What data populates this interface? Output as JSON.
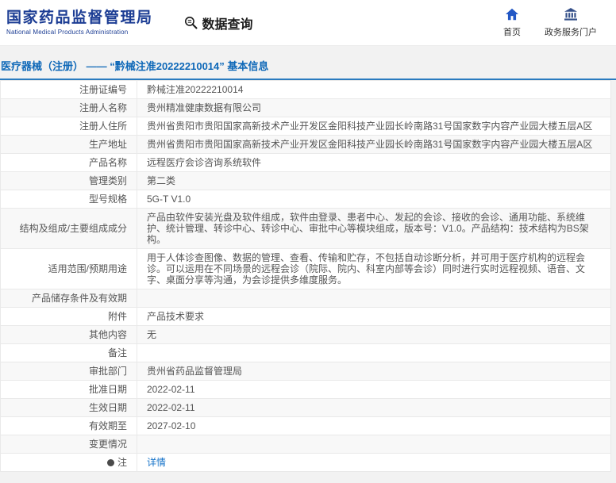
{
  "colors": {
    "brand_blue": "#1c3d94",
    "title_blue": "#0e68b8",
    "link_blue": "#1673c9",
    "accent_line": "#2a7bbf"
  },
  "header": {
    "org_name_cn": "国家药品监督管理局",
    "org_name_en": "National Medical Products Administration",
    "query_label": "数据查询",
    "nav": [
      {
        "label": "首页",
        "icon": "home-icon"
      },
      {
        "label": "政务服务门户",
        "icon": "portal-icon"
      }
    ]
  },
  "page": {
    "title": "医疗器械（注册） ——  “黔械注准20222210014” 基本信息"
  },
  "table": {
    "rows": [
      {
        "label": "注册证编号",
        "value": "黔械注准20222210014"
      },
      {
        "label": "注册人名称",
        "value": "贵州精准健康数据有限公司"
      },
      {
        "label": "注册人住所",
        "value": "贵州省贵阳市贵阳国家高新技术产业开发区金阳科技产业园长岭南路31号国家数字内容产业园大楼五层A区"
      },
      {
        "label": "生产地址",
        "value": "贵州省贵阳市贵阳国家高新技术产业开发区金阳科技产业园长岭南路31号国家数字内容产业园大楼五层A区"
      },
      {
        "label": "产品名称",
        "value": "远程医疗会诊咨询系统软件"
      },
      {
        "label": "管理类别",
        "value": "第二类"
      },
      {
        "label": "型号规格",
        "value": "5G-T V1.0"
      },
      {
        "label": "结构及组成/主要组成成分",
        "value": "产品由软件安装光盘及软件组成，软件由登录、患者中心、发起的会诊、接收的会诊、通用功能、系统维护、统计管理、转诊中心、转诊中心、审批中心等模块组成，版本号：V1.0。产品结构：技术结构为BS架构。"
      },
      {
        "label": "适用范围/预期用途",
        "value": "用于人体诊查图像、数据的管理、查看、传输和贮存，不包括自动诊断分析，并可用于医疗机构的远程会诊。可以运用在不同场景的远程会诊（院际、院内、科室内部等会诊）同时进行实时远程视频、语音、文字、桌面分享等沟通，为会诊提供多维度服务。"
      },
      {
        "label": "产品储存条件及有效期",
        "value": ""
      },
      {
        "label": "附件",
        "value": "产品技术要求"
      },
      {
        "label": "其他内容",
        "value": "无"
      },
      {
        "label": "备注",
        "value": ""
      },
      {
        "label": "审批部门",
        "value": "贵州省药品监督管理局"
      },
      {
        "label": "批准日期",
        "value": "2022-02-11"
      },
      {
        "label": "生效日期",
        "value": "2022-02-11"
      },
      {
        "label": "有效期至",
        "value": "2027-02-10"
      },
      {
        "label": "变更情况",
        "value": ""
      },
      {
        "label": "注",
        "value": "详情",
        "link": true,
        "label_icon": true
      }
    ]
  }
}
